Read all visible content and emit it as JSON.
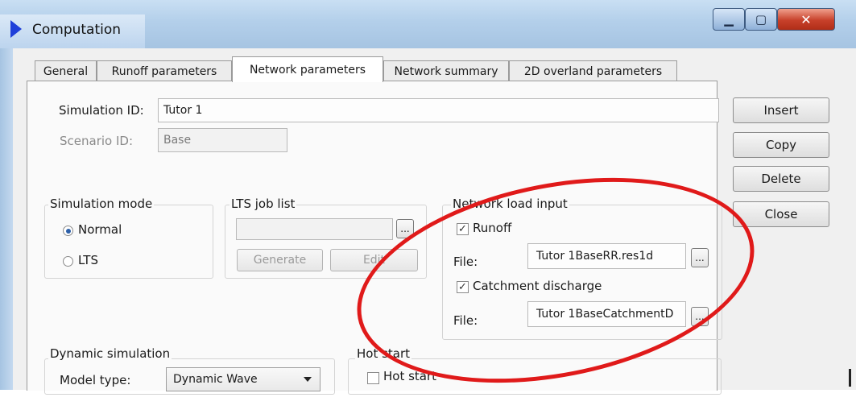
{
  "window": {
    "title": "Computation",
    "min_symbol": "▁",
    "max_symbol": "▢",
    "close_symbol": "✕"
  },
  "tabs": [
    {
      "label": "General",
      "active": false
    },
    {
      "label": "Runoff parameters",
      "active": false
    },
    {
      "label": "Network parameters",
      "active": true
    },
    {
      "label": "Network summary",
      "active": false
    },
    {
      "label": "2D overland parameters",
      "active": false
    }
  ],
  "simulation_id": {
    "label": "Simulation ID:",
    "value": "Tutor 1"
  },
  "scenario_id": {
    "label": "Scenario ID:",
    "value": "Base"
  },
  "side_buttons": {
    "insert": "Insert",
    "copy": "Copy",
    "delete": "Delete",
    "close": "Close"
  },
  "simulation_mode": {
    "title": "Simulation mode",
    "normal": "Normal",
    "lts": "LTS",
    "selected": "Normal"
  },
  "lts_job_list": {
    "title": "LTS job list",
    "value": "",
    "browse": "...",
    "generate": "Generate",
    "edit": "Edit"
  },
  "network_load_input": {
    "title": "Network load input",
    "runoff": {
      "label": "Runoff",
      "checked": true
    },
    "runoff_file": {
      "label": "File:",
      "value": "Tutor 1BaseRR.res1d",
      "browse": "..."
    },
    "catchment": {
      "label": "Catchment discharge",
      "checked": true
    },
    "catchment_file": {
      "label": "File:",
      "value": "Tutor 1BaseCatchmentD",
      "browse": "..."
    }
  },
  "dynamic_simulation": {
    "title": "Dynamic simulation",
    "model_type_label": "Model type:",
    "model_type_value": "Dynamic Wave"
  },
  "hot_start": {
    "title": "Hot start",
    "checkbox_label": "Hot start",
    "checked": false
  },
  "colors": {
    "annotation": "#e01a1a",
    "titlebar": "#b3cfea",
    "close_button": "#c7402a"
  }
}
